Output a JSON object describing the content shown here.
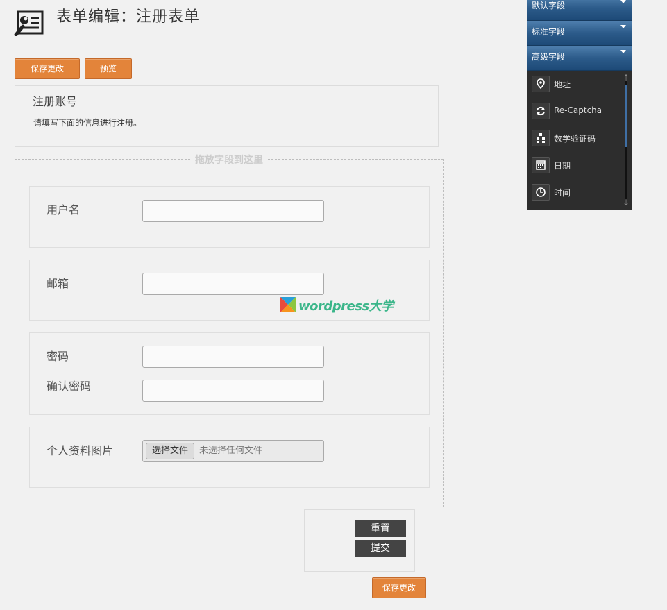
{
  "page": {
    "title": "表单编辑：注册表单"
  },
  "toolbar": {
    "save_label": "保存更改",
    "preview_label": "预览"
  },
  "intro": {
    "title": "注册账号",
    "description": "请填写下面的信息进行注册。"
  },
  "dropzone": {
    "label": "拖放字段到这里"
  },
  "fields": {
    "username": {
      "label": "用户名"
    },
    "email": {
      "label": "邮箱"
    },
    "password": {
      "label": "密码"
    },
    "confirm_password": {
      "label": "确认密码"
    },
    "avatar": {
      "label": "个人资料图片",
      "button": "选择文件",
      "status": "未选择任何文件"
    }
  },
  "watermark": {
    "text": "wordpress大学"
  },
  "form_buttons": {
    "reset": "重置",
    "submit": "提交"
  },
  "footer": {
    "save_label": "保存更改"
  },
  "side_panel": {
    "sections": [
      {
        "label": "默认字段"
      },
      {
        "label": "标准字段"
      },
      {
        "label": "高级字段"
      }
    ],
    "items": [
      {
        "label": "地址",
        "icon": "map-pin-icon"
      },
      {
        "label": "Re-Captcha",
        "icon": "recaptcha-icon"
      },
      {
        "label": "数学验证码",
        "icon": "math-captcha-icon"
      },
      {
        "label": "日期",
        "icon": "calendar-icon"
      },
      {
        "label": "时间",
        "icon": "clock-icon"
      }
    ]
  },
  "colors": {
    "accent": "#e3843a",
    "panel_header": "#2c5b8a",
    "panel_bg": "#2d2d2d",
    "dark_button": "#444444"
  }
}
